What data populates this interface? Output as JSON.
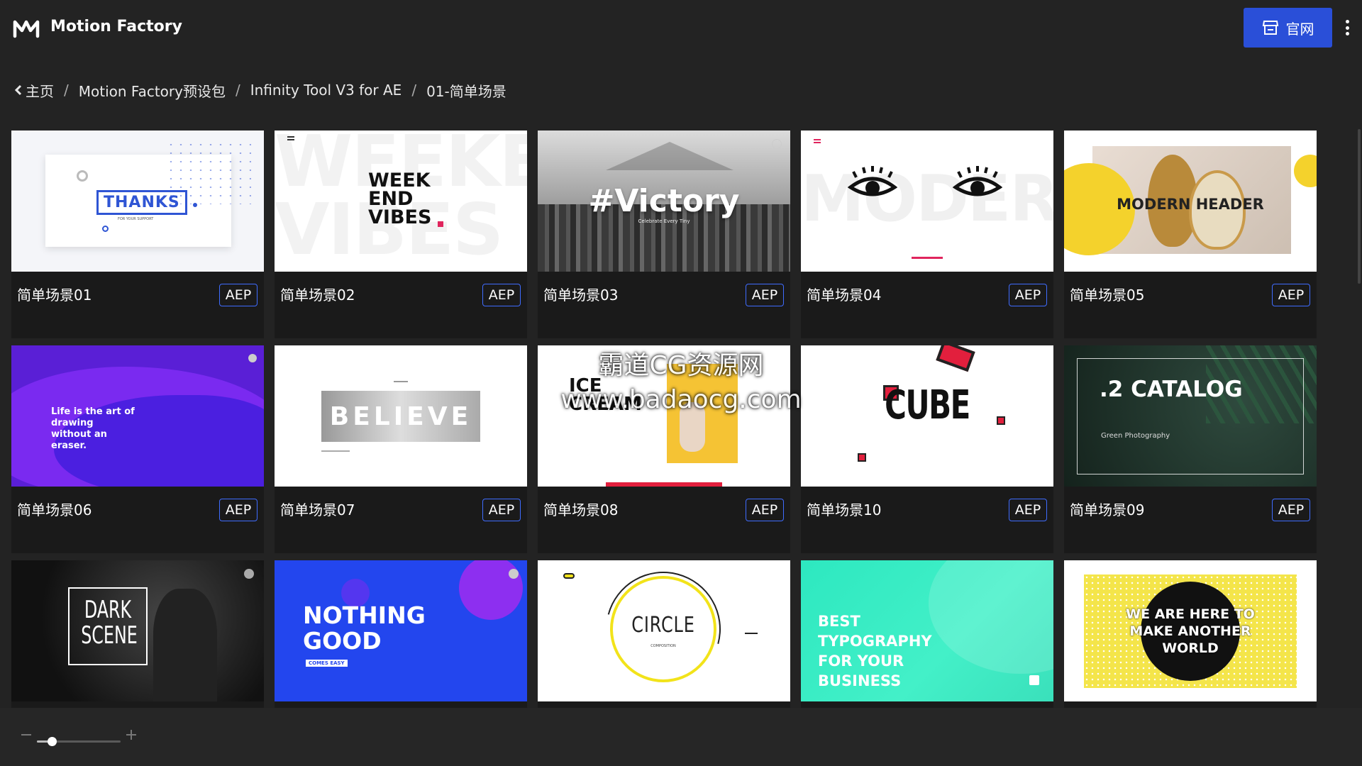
{
  "app": {
    "title": "Motion Factory"
  },
  "header": {
    "site_button_label": "官网"
  },
  "breadcrumb": {
    "items": [
      "主页",
      "Motion Factory预设包",
      "Infinity Tool V3 for AE",
      "01-简单场景"
    ],
    "separator": "/"
  },
  "badge_label": "AEP",
  "cards": [
    {
      "name": "简单场景01",
      "thumb_text": "THANKS",
      "thumb_sub": "FOR YOUR SUPPORT"
    },
    {
      "name": "简单场景02",
      "thumb_text": "WEEK END VIBES",
      "thumb_bg_text": "WEEKEND VIBES"
    },
    {
      "name": "简单场景03",
      "thumb_text": "#Victory",
      "thumb_sub": "Celebrate Every Tiny"
    },
    {
      "name": "简单场景04",
      "thumb_bg_text": "MODERN"
    },
    {
      "name": "简单场景05",
      "thumb_text": "MODERN HEADER"
    },
    {
      "name": "简单场景06",
      "thumb_text": "Life is the art of drawing without an eraser."
    },
    {
      "name": "简单场景07",
      "thumb_text": "BELIEVE"
    },
    {
      "name": "简单场景08",
      "thumb_text": "ICE CREAM"
    },
    {
      "name": "简单场景10",
      "thumb_text": "CUBE"
    },
    {
      "name": "简单场景09",
      "thumb_text": ".2 CATALOG",
      "thumb_sub": "Green Photography"
    },
    {
      "name": "",
      "thumb_text": "DARK SCENE"
    },
    {
      "name": "",
      "thumb_text": "NOTHING GOOD",
      "thumb_sub": "COMES EASY"
    },
    {
      "name": "",
      "thumb_text": "CIRCLE",
      "thumb_sub": "COMPOSITION"
    },
    {
      "name": "",
      "thumb_text": "BEST TYPOGRAPHY FOR YOUR BUSINESS"
    },
    {
      "name": "",
      "thumb_text": "WE ARE HERE TO MAKE ANOTHER WORLD"
    }
  ],
  "zoom": {
    "level": 0.18
  },
  "watermark": {
    "line1": "霸道CG资源网",
    "line2": "www.badaocg.com"
  },
  "colors": {
    "accent": "#2a4fd8",
    "badge_border": "#3f6cff",
    "background": "#232323",
    "card": "#1a1a1a"
  }
}
